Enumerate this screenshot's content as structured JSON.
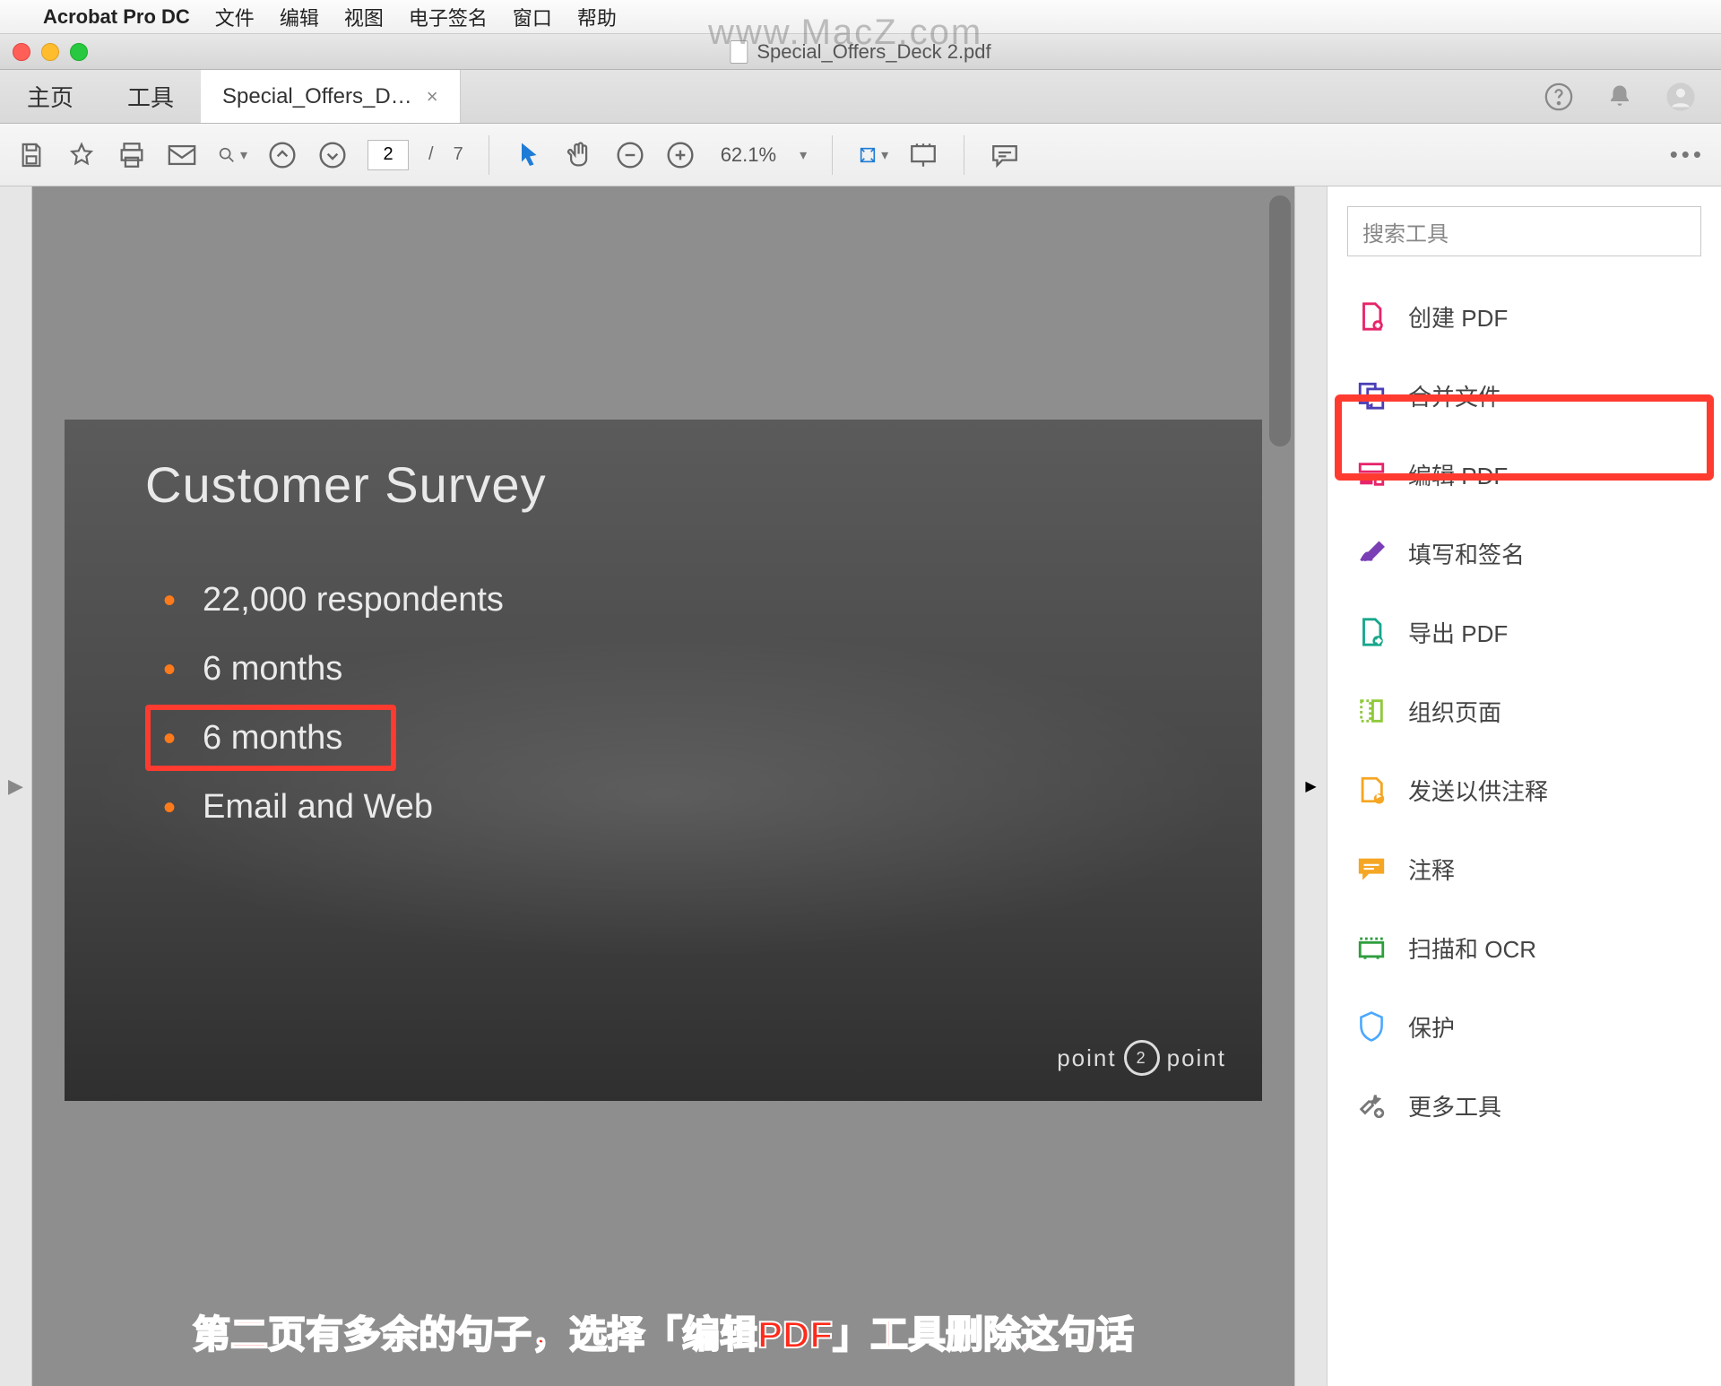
{
  "menubar": {
    "app": "Acrobat Pro DC",
    "items": [
      "文件",
      "编辑",
      "视图",
      "电子签名",
      "窗口",
      "帮助"
    ]
  },
  "watermark": "www.MacZ.com",
  "window": {
    "title": "Special_Offers_Deck 2.pdf"
  },
  "tabs": {
    "home": "主页",
    "tools": "工具",
    "doc": "Special_Offers_D…"
  },
  "toolbar": {
    "page_current": "2",
    "page_sep": "/",
    "page_total": "7",
    "zoom": "62.1%"
  },
  "slide": {
    "title": "Customer Survey",
    "bullets": [
      "22,000 respondents",
      "6 months",
      "6 months",
      "Email and Web"
    ],
    "brand_left": "point",
    "brand_right": "point",
    "brand_mid": "2"
  },
  "tools_panel": {
    "search_placeholder": "搜索工具",
    "items": [
      "创建 PDF",
      "合并文件",
      "编辑 PDF",
      "填写和签名",
      "导出 PDF",
      "组织页面",
      "发送以供注释",
      "注释",
      "扫描和 OCR",
      "保护",
      "更多工具"
    ]
  },
  "caption": "第二页有多余的句子，选择「编辑PDF」工具删除这句话",
  "colors": {
    "highlight": "#ff3b30",
    "tool_icons": [
      "#e6246b",
      "#4a3fb5",
      "#e6246b",
      "#7a3fb5",
      "#17a68c",
      "#8fc93a",
      "#f5a623",
      "#f5a623",
      "#2e9e3f",
      "#4aa8ff",
      "#777777"
    ]
  }
}
